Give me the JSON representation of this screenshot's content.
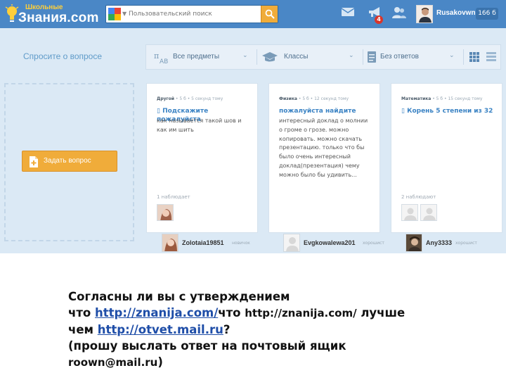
{
  "header": {
    "logo_small": "Школьные",
    "logo_big": "Знания.com",
    "search_brand": "Google",
    "search_placeholder": "Пользовательский поиск",
    "notification_count": "4",
    "user_name": "Rusakovwn",
    "points": "166 б",
    "colors": {
      "bar": "#4a87c6",
      "accent": "#f0ac3a"
    }
  },
  "ask": {
    "title": "Спросите о вопросе",
    "button_label": "Задать вопрос"
  },
  "filters": {
    "subjects": "Все предметы",
    "classes": "Классы",
    "answers": "Без ответов"
  },
  "cards": [
    {
      "subject": "Другой",
      "meta": " • 5 б • 5 секунд тому",
      "title": "Подскажите пожалуйста",
      "text": "как называется такой шов и как им шить",
      "watchers": "1 наблюдает",
      "author": "Zolotaia19851",
      "rank": "новичок"
    },
    {
      "subject": "Физика",
      "meta": " • 5 б • 12 секунд тому",
      "title": "пожалуйста найдите",
      "text": "интересный доклад о молнии о громе о грозе. можно копировать. можно скачать презентацию. только что бы было очень интересный доклад(презентация) чему можно было бы удивить...",
      "watchers": "",
      "author": "Evgkowalewa201",
      "rank": "хорошист"
    },
    {
      "subject": "Математика",
      "meta": " • 5 б • 15 секунд тому",
      "title": "Корень 5 степени из 32",
      "text": "",
      "watchers": "2 наблюдают",
      "author": "Any3333",
      "rank": "хорошист"
    }
  ],
  "caption": {
    "line1": "Согласны ли вы с утверждением",
    "line2_pre": "что ",
    "link1": "http://znanija.com/",
    "line2_mid": "что ",
    "line2_plain": "http://znanija.com/",
    "line2_post": " лучше",
    "line3_pre": "чем ",
    "link2": "http://otvet.mail.ru",
    "line3_post": "?",
    "line4": "(прошу выслать ответ на почтовый ящик",
    "email": "roown@mail.ru",
    "line5_post": ")"
  }
}
